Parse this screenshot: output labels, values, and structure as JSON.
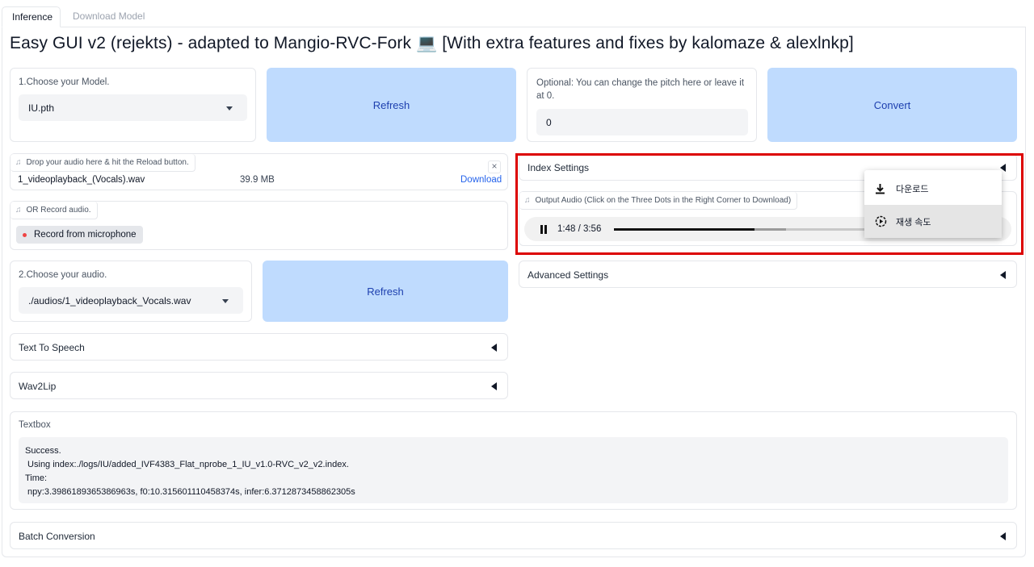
{
  "tabs": [
    {
      "label": "Inference",
      "active": true
    },
    {
      "label": "Download Model",
      "active": false
    }
  ],
  "title": "Easy GUI v2 (rejekts) - adapted to Mangio-RVC-Fork 💻 [With extra features and fixes by kalomaze & alexlnkp]",
  "model": {
    "label": "1.Choose your Model.",
    "value": "IU.pth"
  },
  "refresh_top": {
    "label": "Refresh"
  },
  "pitch": {
    "label": "Optional: You can change the pitch here or leave it at 0.",
    "value": "0"
  },
  "convert": {
    "label": "Convert"
  },
  "upload": {
    "chip": "Drop your audio here & hit the Reload button.",
    "filename": "1_videoplayback_(Vocals).wav",
    "size": "39.9 MB",
    "download": "Download",
    "close": "×"
  },
  "record": {
    "chip": "OR Record audio.",
    "button": "Record from microphone"
  },
  "audio_choice": {
    "label": "2.Choose your audio.",
    "value": "./audios/1_videoplayback_Vocals.wav"
  },
  "refresh_bottom": {
    "label": "Refresh"
  },
  "accordions": {
    "index_settings": "Index Settings",
    "advanced_settings": "Advanced Settings",
    "text_to_speech": "Text To Speech",
    "wav2lip": "Wav2Lip",
    "batch_conversion": "Batch Conversion"
  },
  "output_audio": {
    "chip": "Output Audio (Click on the Three Dots in the Right Corner to Download)",
    "time": "1:48 / 3:56",
    "progress_fraction": 0.458,
    "buffered_fraction": 0.56
  },
  "context_menu": {
    "items": [
      {
        "label": "다운로드",
        "icon": "download-icon"
      },
      {
        "label": "재생 속도",
        "icon": "playback-speed-icon"
      }
    ]
  },
  "textbox": {
    "label": "Textbox",
    "lines": [
      "Success.",
      " Using index:./logs/IU/added_IVF4383_Flat_nprobe_1_IU_v1.0-RVC_v2_v2.index.",
      "Time:",
      " npy:3.3986189365386963s, f0:10.315601110458374s, infer:6.3712873458862305s"
    ]
  },
  "colors": {
    "accent_button": "#bfdbfe",
    "accent_text": "#1e40af",
    "highlight_box": "#dc0000",
    "record_dot": "#ef4444"
  }
}
